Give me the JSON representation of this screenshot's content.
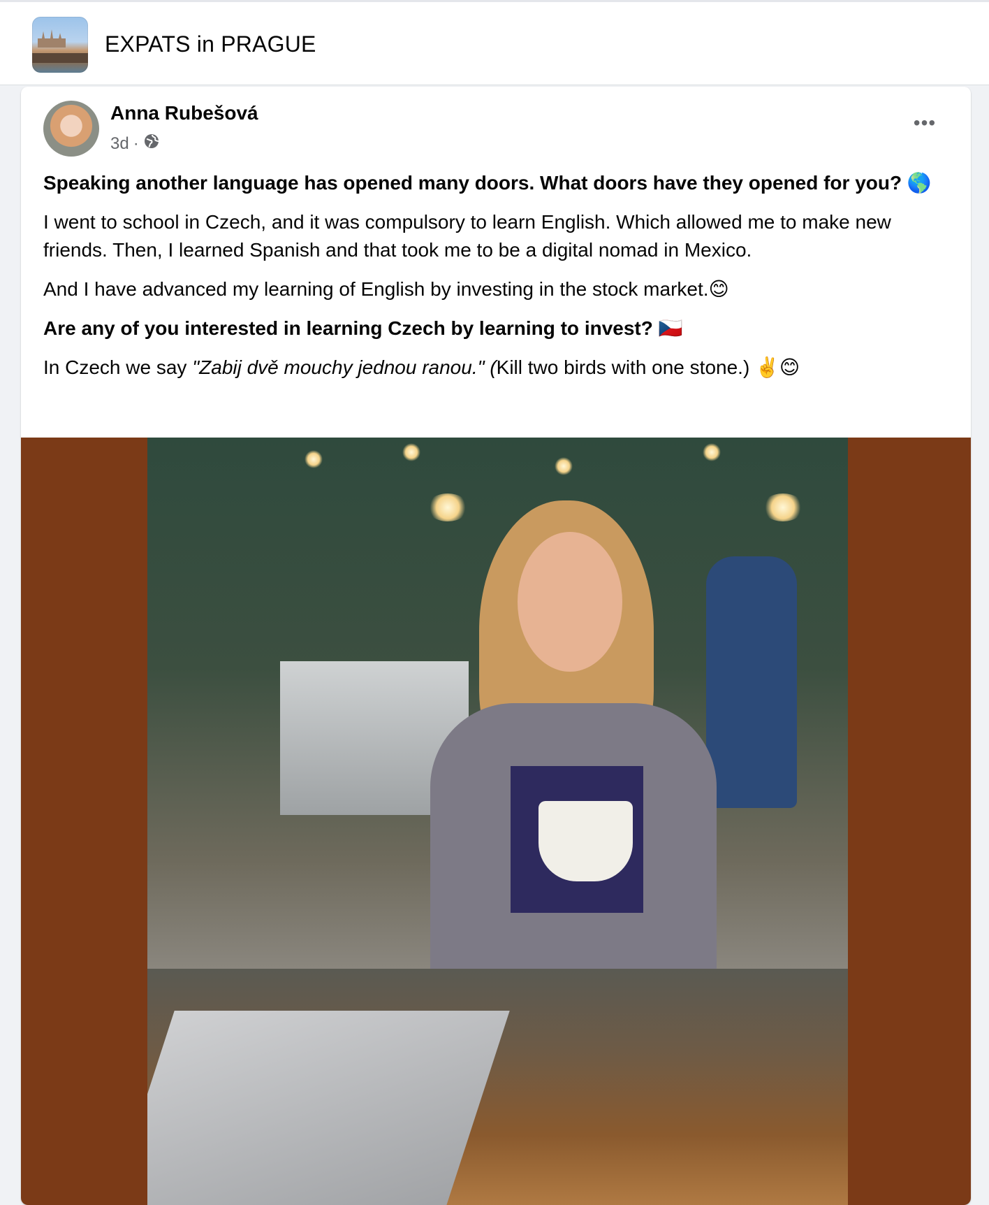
{
  "group": {
    "name": "EXPATS in PRAGUE",
    "thumbnail_icon": "prague-castle-thumbnail"
  },
  "post": {
    "author": "Anna Rubešová",
    "age": "3d",
    "separator": "·",
    "privacy_icon": "globe-icon",
    "more_label": "•••",
    "paragraphs": {
      "p1": "Speaking another language has opened many doors. What doors have they opened for you? 🌎",
      "p2": "I went to school in Czech, and it was compulsory to learn English. Which allowed me to make new friends. Then, I learned Spanish and that took me to be a digital nomad in Mexico.",
      "p3": "And I have advanced my learning of English by investing in the stock market.😊",
      "p4": "Are any of you interested in learning Czech by learning to invest? 🇨🇿",
      "p5_prefix": "In Czech we say ",
      "p5_italic": "\"Zabij dvě mouchy jednou ranou.\" (",
      "p5_suffix": "Kill two birds with one stone.)  ✌️😊"
    },
    "photo_background": "#7b3a17"
  },
  "colors": {
    "page_bg": "#f0f2f5",
    "card_bg": "#ffffff",
    "muted_text": "#65676b"
  }
}
